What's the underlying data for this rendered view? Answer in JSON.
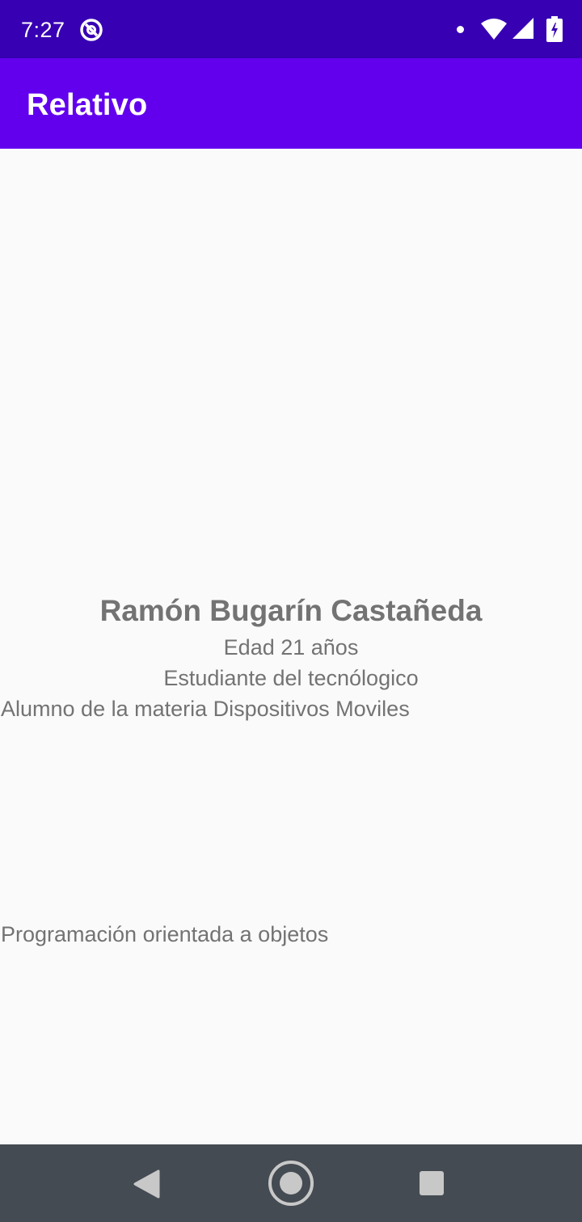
{
  "status_bar": {
    "time": "7:27",
    "icons": [
      "at-sign-icon",
      "notification-dot-icon",
      "wifi-icon",
      "signal-icon",
      "battery-icon"
    ],
    "background": "#3700b3"
  },
  "app_bar": {
    "title": "Relativo",
    "background": "#6200ee"
  },
  "profile": {
    "name": "Ramón Bugarín Castañeda",
    "age": "Edad 21 años",
    "occupation": "Estudiante del tecnólogico",
    "subject": "Alumno de la materia Dispositivos Moviles",
    "course": "Programación orientada a objetos",
    "text_color": "#737373"
  },
  "nav_bar": {
    "buttons": [
      "back-icon",
      "home-icon",
      "recents-icon"
    ],
    "background": "#444b52"
  }
}
